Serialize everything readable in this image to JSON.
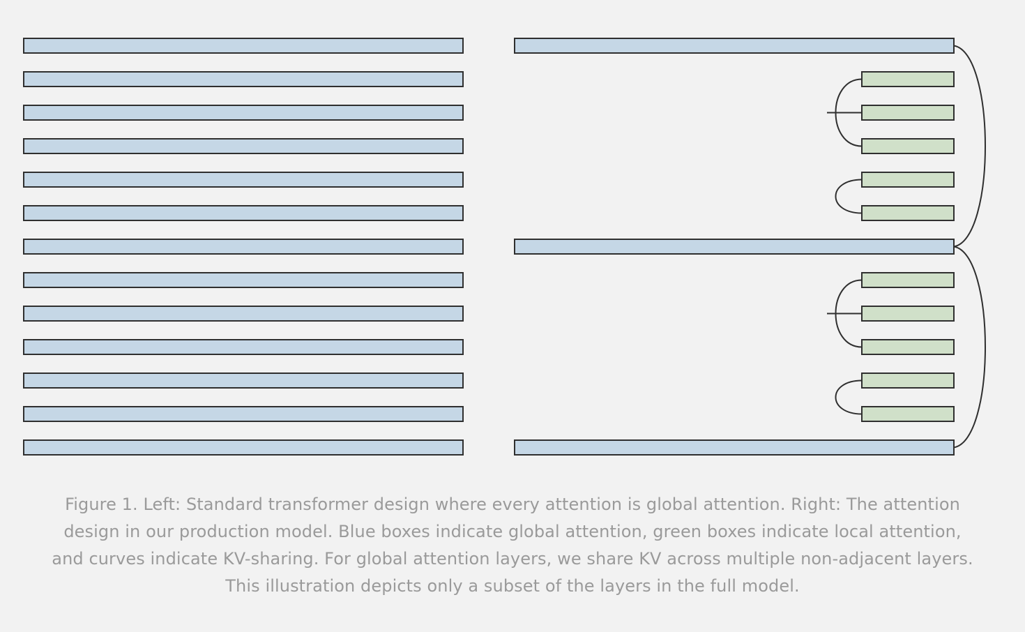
{
  "diagram": {
    "colors": {
      "global_fill": "#c5d7e6",
      "local_fill": "#d0e0c9",
      "stroke": "#2f2f2f",
      "background": "#f2f2f2",
      "caption": "#9a9a9a"
    },
    "left_column": {
      "layers": [
        "global",
        "global",
        "global",
        "global",
        "global",
        "global",
        "global",
        "global",
        "global",
        "global",
        "global",
        "global",
        "global"
      ]
    },
    "right_column": {
      "layers": [
        "global",
        "local",
        "local",
        "local",
        "local",
        "local",
        "global",
        "local",
        "local",
        "local",
        "local",
        "local",
        "global"
      ],
      "kv_sharing": [
        {
          "kind": "global",
          "layers": [
            0,
            6
          ]
        },
        {
          "kind": "global",
          "layers": [
            6,
            12
          ]
        },
        {
          "kind": "local",
          "layers": [
            1,
            2,
            3
          ]
        },
        {
          "kind": "local",
          "layers": [
            4,
            5
          ]
        },
        {
          "kind": "local",
          "layers": [
            7,
            8,
            9
          ]
        },
        {
          "kind": "local",
          "layers": [
            10,
            11
          ]
        }
      ]
    }
  },
  "caption": {
    "line1": "Figure 1. Left: Standard transformer design where every attention is global attention. Right: The attention",
    "line2": "design in our production model. Blue boxes indicate global attention, green boxes indicate local attention,",
    "line3": "and curves indicate KV-sharing. For global attention layers, we share KV across multiple non-adjacent layers.",
    "line4": "This illustration depicts only a subset of the layers in the full model."
  }
}
